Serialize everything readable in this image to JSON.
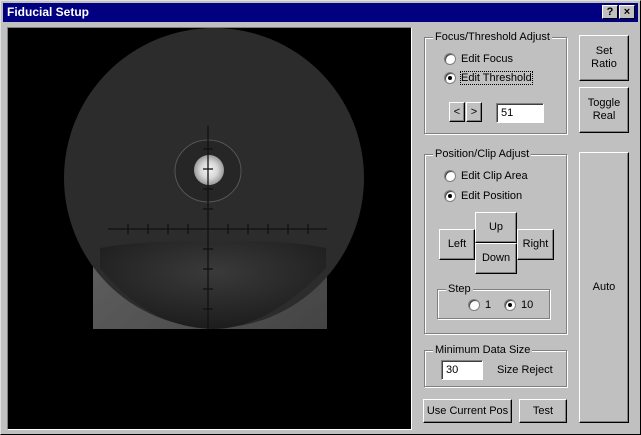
{
  "window": {
    "title": "Fiducial Setup",
    "help_label": "?",
    "close_label": "×"
  },
  "focus_threshold": {
    "group_label": "Focus/Threshold Adjust",
    "edit_focus_label": "Edit Focus",
    "edit_threshold_label": "Edit Threshold",
    "selected": "Edit Threshold",
    "decrement_label": "<",
    "increment_label": ">",
    "value": "51"
  },
  "position_clip": {
    "group_label": "Position/Clip Adjust",
    "edit_clip_label": "Edit Clip Area",
    "edit_position_label": "Edit Position",
    "selected": "Edit Position",
    "left_label": "Left",
    "up_label": "Up",
    "down_label": "Down",
    "right_label": "Right",
    "step": {
      "group_label": "Step",
      "option_1": "1",
      "option_10": "10",
      "selected": "10"
    }
  },
  "min_data": {
    "group_label": "Minimum Data Size",
    "value": "30",
    "size_reject_label": "Size Reject"
  },
  "buttons": {
    "set_ratio_label": "Set Ratio",
    "toggle_real_label": "Toggle Real",
    "auto_label": "Auto",
    "use_current_pos_label": "Use Current Pos",
    "test_label": "Test"
  },
  "colors": {
    "title_bar": "#000080",
    "face": "#c0c0c0"
  }
}
